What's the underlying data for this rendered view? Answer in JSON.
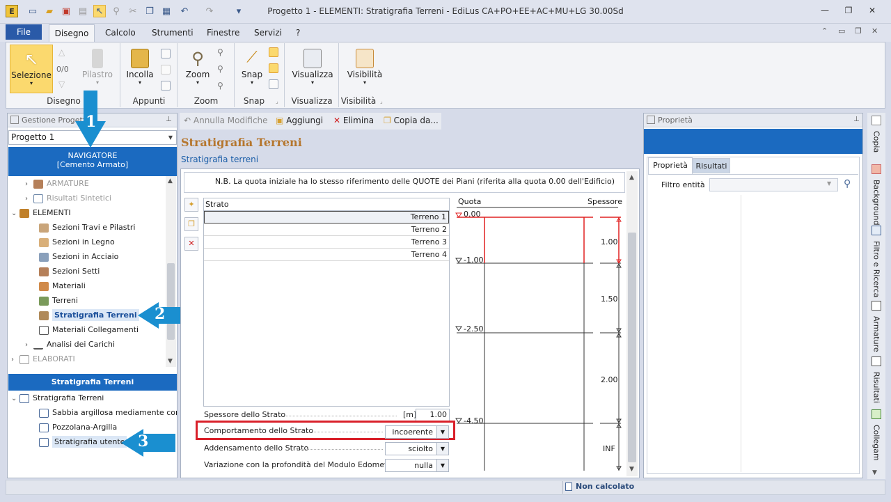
{
  "window": {
    "title": "Progetto 1 -  ELEMENTI: Stratigrafia Terreni - EdiLus CA+PO+EE+AC+MU+LG 30.00Sd"
  },
  "menu": {
    "file": "File",
    "tabs": [
      "Disegno",
      "Calcolo",
      "Strumenti",
      "Finestre",
      "Servizi",
      "?"
    ]
  },
  "ribbon": {
    "groups": [
      {
        "label": "Disegno",
        "buttons": [
          "Selezione",
          "Pilastro"
        ],
        "counter": "0/0"
      },
      {
        "label": "Appunti",
        "buttons": [
          "Incolla"
        ]
      },
      {
        "label": "Zoom",
        "buttons": [
          "Zoom"
        ]
      },
      {
        "label": "Snap",
        "buttons": [
          "Snap"
        ]
      },
      {
        "label": "Visualizza",
        "buttons": [
          "Visualizza"
        ]
      },
      {
        "label": "Visibilità",
        "buttons": [
          "Visibilità"
        ]
      }
    ]
  },
  "left_panel": {
    "header": "Gestione Progetto",
    "project_select": "Progetto 1",
    "navigator_line1": "NAVIGATORE",
    "navigator_line2": "[Cemento Armato]",
    "tree": [
      "ARMATURE",
      "Risultati Sintetici",
      "ELEMENTI",
      "Sezioni Travi e Pilastri",
      "Sezioni in Legno",
      "Sezioni in Acciaio",
      "Sezioni Setti",
      "Materiali",
      "Terreni",
      "Stratigrafia Terreni",
      "Materiali Collegamenti",
      "Analisi dei Carichi",
      "ELABORATI"
    ],
    "bottom_header": "Stratigrafia Terreni",
    "bottom_tree": [
      "Stratigrafia Terreni",
      "Sabbia argillosa mediamente consolid",
      "Pozzolana-Argilla",
      "Stratigrafia utente"
    ],
    "callouts": [
      "1",
      "2",
      "3"
    ]
  },
  "center": {
    "toolbar": [
      "Annulla Modifiche",
      "Aggiungi",
      "Elimina",
      "Copia da..."
    ],
    "heading": "Stratigrafia Terreni",
    "subheading": "Stratigrafia terreni",
    "note": "N.B. La quota iniziale ha lo stesso riferimento delle QUOTE dei Piani (riferita alla quota 0.00 dell'Edificio)",
    "table_header": "Strato",
    "rows": [
      "Terreno 1",
      "Terreno 2",
      "Terreno 3",
      "Terreno 4"
    ],
    "fields": {
      "spessore_label": "Spessore dello Strato",
      "spessore_unit": "[m]",
      "spessore_value": "1.00",
      "comportamento_label": "Comportamento dello Strato",
      "comportamento_value": "incoerente",
      "addensamento_label": "Addensamento dello Strato",
      "addensamento_value": "sciolto",
      "variazione_label": "Variazione con la profondità del Modulo Edometrico",
      "variazione_value": "nulla"
    },
    "profile": {
      "quota_label": "Quota",
      "spessore_label": "Spessore",
      "quote": [
        "0.00",
        "-1.00",
        "-2.50",
        "-4.50"
      ],
      "spessori": [
        "1.00",
        "1.50",
        "2.00",
        "INF"
      ],
      "highlight_color": "#e02020"
    }
  },
  "right_panel": {
    "header": "Proprietà",
    "tabs": [
      "Proprietà",
      "Risultati"
    ],
    "filter_label": "Filtro entità",
    "side_tabs": [
      "Copia",
      "Background",
      "Filtro e Ricerca",
      "Armature",
      "Risultati",
      "Collegam"
    ]
  },
  "status": {
    "text": "Non calcolato"
  }
}
